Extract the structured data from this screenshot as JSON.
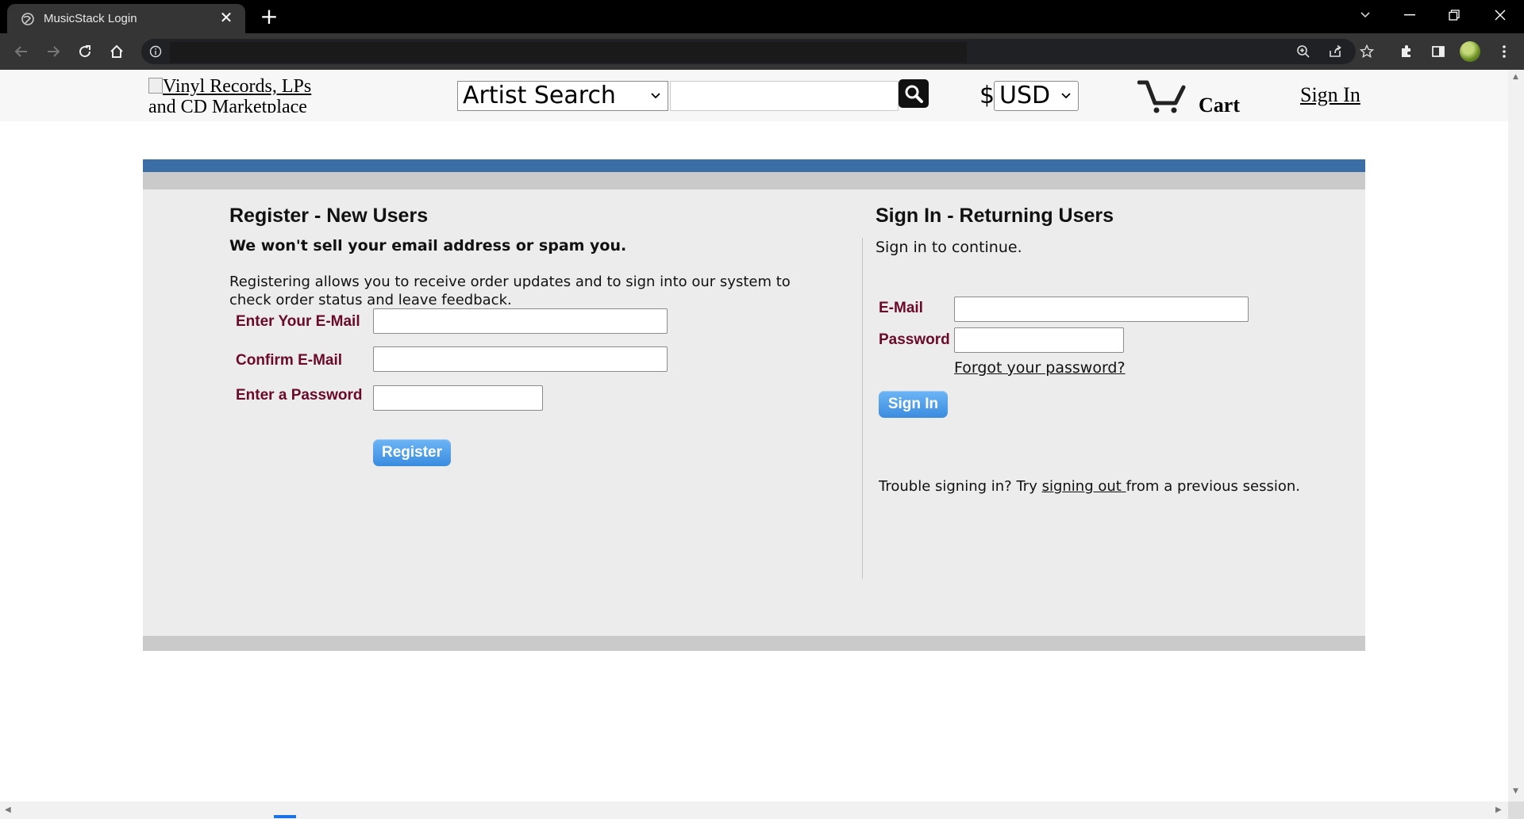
{
  "browser": {
    "tab_title": "MusicStack Login",
    "url": "",
    "new_tab": "+",
    "tab_close": "✕"
  },
  "site": {
    "logo_alt_line1": "Vinyl Records, LPs",
    "logo_alt_line2": "and CD Marketplace",
    "search_type": "Artist Search",
    "search_value": "",
    "currency_symbol": "$",
    "currency": "USD",
    "cart_label": "Cart",
    "signin_link": "Sign In"
  },
  "register": {
    "heading": "Register - New Users",
    "subheading": "We won't sell your email address or spam you.",
    "description": "Registering allows you to receive order updates and to sign into our system to check order status and leave feedback.",
    "email_label": "Enter Your E-Mail",
    "confirm_label": "Confirm E-Mail",
    "password_label": "Enter a Password",
    "button": "Register"
  },
  "signin": {
    "heading": "Sign In - Returning Users",
    "subheading": "Sign in to continue.",
    "email_label": "E-Mail",
    "password_label": "Password",
    "forgot": "Forgot your password?",
    "button": "Sign In",
    "trouble_prefix": "Trouble signing in? Try",
    "trouble_link": "signing out ",
    "trouble_suffix": "from a previous session."
  },
  "colors": {
    "accent_blue": "#3a6ea5",
    "label_maroon": "#6a0a2a",
    "button_blue": "#4a9be6"
  }
}
